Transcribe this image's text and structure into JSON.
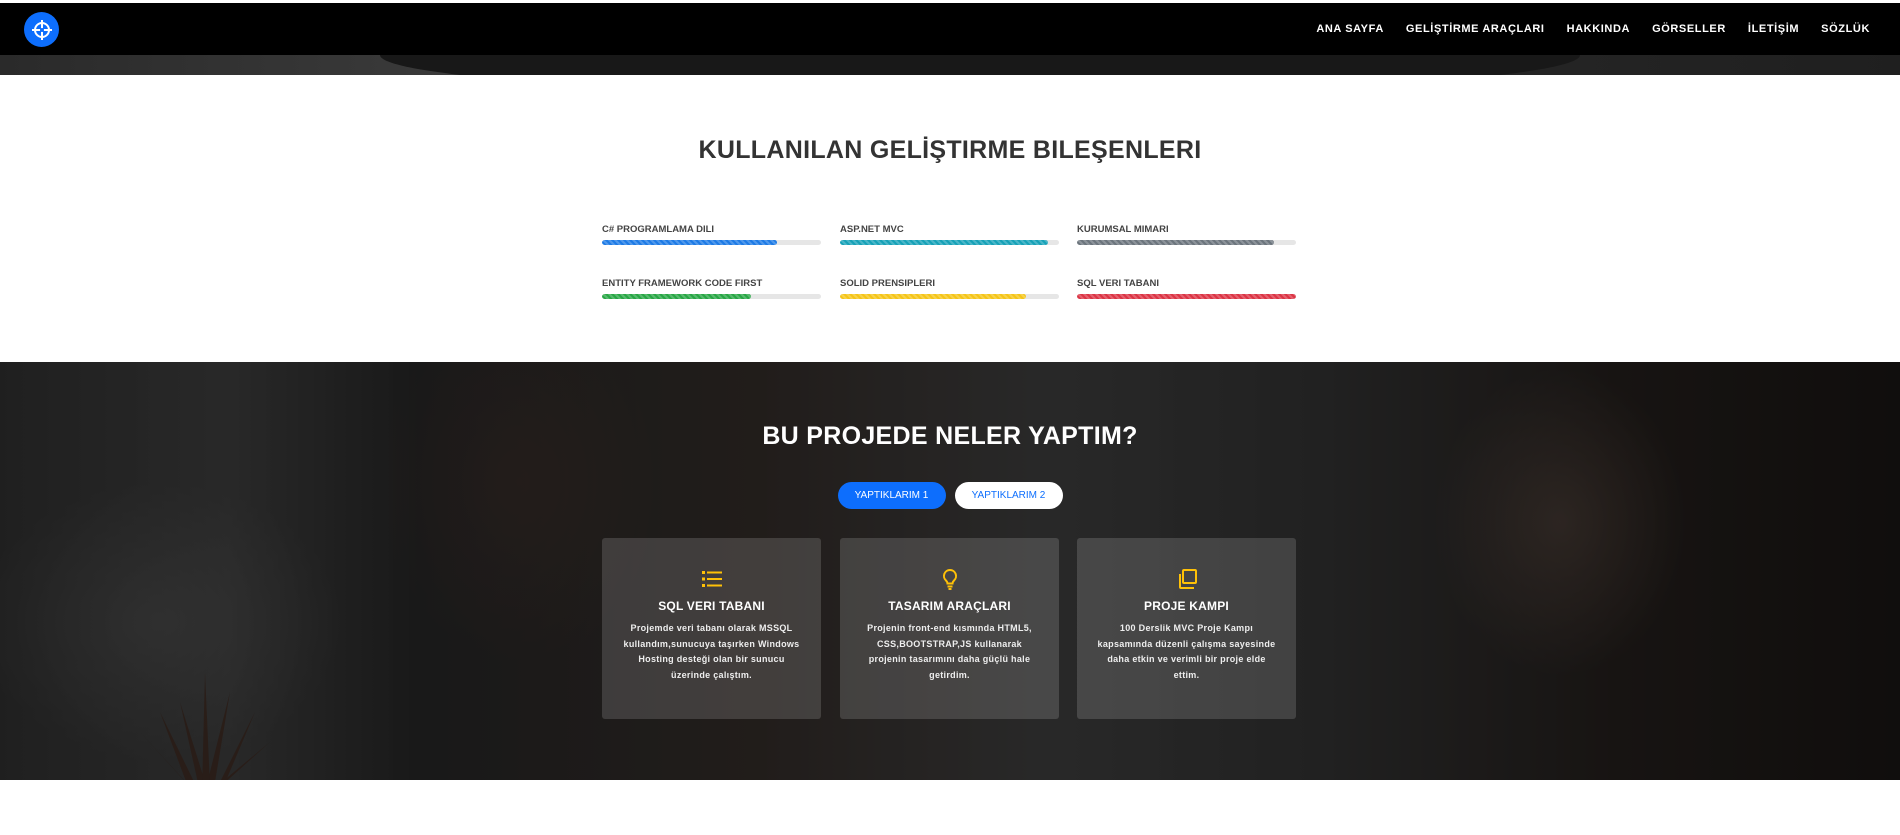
{
  "nav": {
    "items": [
      "ANA SAYFA",
      "GELİŞTİRME ARAÇLARI",
      "HAKKINDA",
      "GÖRSELLER",
      "İLETİŞİM",
      "SÖZLÜK"
    ]
  },
  "skills": {
    "title": "KULLANILAN GELİŞTIRME BILEŞENLERI",
    "items": [
      {
        "label": "C# PROGRAMLAMA DILI",
        "percent": 80,
        "color": "#1e7be6"
      },
      {
        "label": "ASP.NET MVC",
        "percent": 95,
        "color": "#17a2b8"
      },
      {
        "label": "KURUMSAL MIMARI",
        "percent": 90,
        "color": "#6c757d"
      },
      {
        "label": "ENTITY FRAMEWORK CODE FIRST",
        "percent": 68,
        "color": "#28a745"
      },
      {
        "label": "SOLID PRENSIPLERI",
        "percent": 85,
        "color": "#f5c518"
      },
      {
        "label": "SQL VERI TABANI",
        "percent": 100,
        "color": "#dc3545"
      }
    ]
  },
  "projects": {
    "title": "BU PROJEDE NELER YAPTIM?",
    "tab_1": "YAPTIKLARIM 1",
    "tab_2": "YAPTIKLARIM 2",
    "icon_color": "#ffc107",
    "cards": [
      {
        "icon": "list-icon",
        "title": "SQL VERI TABANI",
        "text": "Projemde veri tabanı olarak MSSQL kullandım,sunucuya taşırken Windows Hosting desteği olan bir sunucu üzerinde çalıştım."
      },
      {
        "icon": "lightbulb-icon",
        "title": "TASARIM ARAÇLARI",
        "text": "Projenin front-end kısmında HTML5, CSS,BOOTSTRAP,JS kullanarak projenin tasarımını daha güçlü hale getirdim."
      },
      {
        "icon": "copy-icon",
        "title": "PROJE KAMPI",
        "text": "100 Derslik MVC Proje Kampı kapsamında düzenli çalışma sayesinde daha etkin ve verimli bir proje elde ettim."
      }
    ]
  }
}
